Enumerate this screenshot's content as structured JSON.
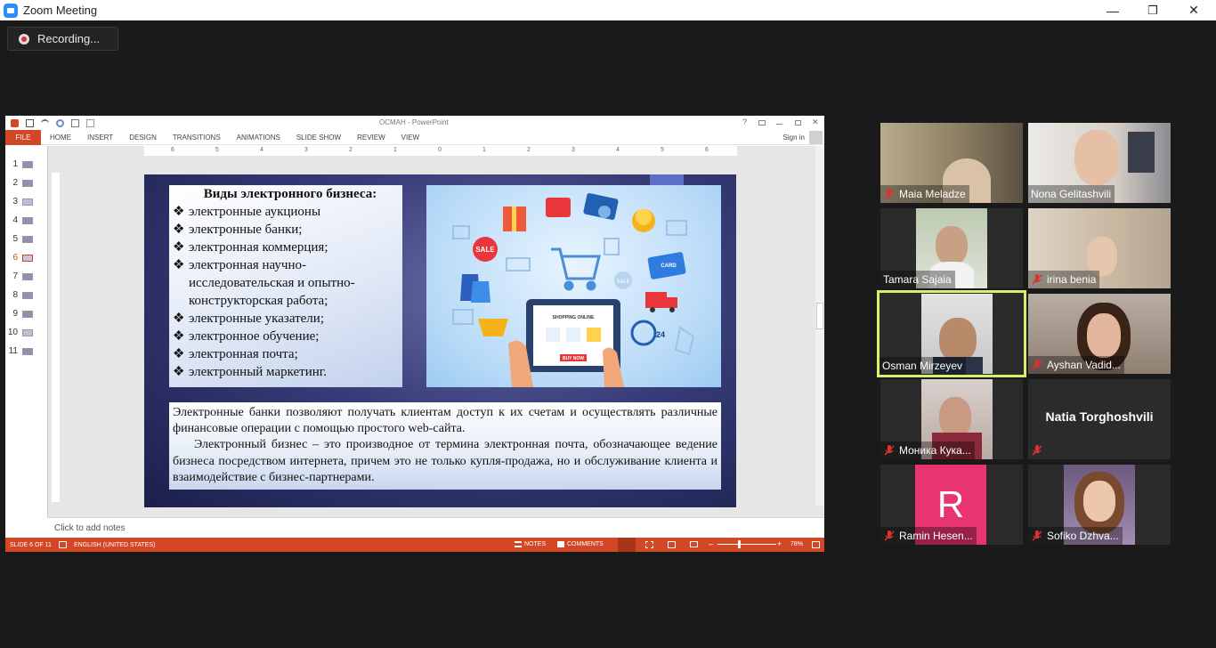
{
  "window": {
    "title": "Zoom Meeting",
    "minimize": "—",
    "restore": "❐",
    "close": "✕"
  },
  "recording": {
    "label": "Recording..."
  },
  "ppt": {
    "doc_title": "OCMAH - PowerPoint",
    "help": "?",
    "file_tab": "FILE",
    "tabs": [
      "HOME",
      "INSERT",
      "DESIGN",
      "TRANSITIONS",
      "ANIMATIONS",
      "SLIDE SHOW",
      "REVIEW",
      "VIEW"
    ],
    "signin": "Sign in",
    "slides": [
      "1",
      "2",
      "3",
      "4",
      "5",
      "6",
      "7",
      "8",
      "9",
      "10",
      "11"
    ],
    "ruler_marks": [
      "6",
      "5",
      "4",
      "3",
      "2",
      "1",
      "0",
      "1",
      "2",
      "3",
      "4",
      "5",
      "6"
    ],
    "notes_placeholder": "Click to add notes",
    "status": {
      "slide": "SLIDE 6 OF 11",
      "language": "ENGLISH (UNITED STATES)",
      "notes": "NOTES",
      "comments": "COMMENTS",
      "zoom": "78%"
    }
  },
  "slide": {
    "heading": "Виды электронного бизнеса:",
    "bullets": [
      {
        "b": "❖",
        "t": "электронные аукционы"
      },
      {
        "b": "❖",
        "t": "электронные банки;"
      },
      {
        "b": "❖",
        "t": "электронная коммерция;"
      },
      {
        "b": "❖",
        "t": "электронная научно-"
      },
      {
        "b": "",
        "t": "исследовательская и опытно-"
      },
      {
        "b": "",
        "t": "конструкторская работа;"
      },
      {
        "b": "❖",
        "t": "электронные указатели;"
      },
      {
        "b": "❖",
        "t": "электронное обучение;"
      },
      {
        "b": "❖",
        "t": " электронная почта;"
      },
      {
        "b": "❖",
        "t": "электронный маркетинг."
      }
    ],
    "image_labels": {
      "sale": "SALE",
      "sale2": "SALE",
      "card": "CARD",
      "shopping_online": "SHOPPING ONLINE",
      "buy_now": "BUY NOW",
      "clock_24": "24"
    },
    "paragraph1": "Электронные банки позволяют получать клиентам доступ к их счетам и осуществлять различные финансовые операции с помощью простого web-сайта.",
    "paragraph2": "Электронный бизнес – это производное от термина электронная почта, обозначающее ведение бизнеса посредством интернета, причем это не только купля-продажа, но и обслуживание клиента и взаимодействие с бизнес-партнерами."
  },
  "participants": [
    {
      "name": "Maia Meladze",
      "muted": true
    },
    {
      "name": "Nona Gelitashvili",
      "muted": false
    },
    {
      "name": "Tamara Sajaia",
      "muted": false
    },
    {
      "name": "irina benia",
      "muted": true
    },
    {
      "name": "Osman Mirzeyev",
      "muted": false,
      "speaking": true
    },
    {
      "name": "Ayshan Vadid...",
      "muted": true
    },
    {
      "name": "Моника Кука...",
      "muted": true
    },
    {
      "name": "Natia Torghoshvili",
      "muted": true,
      "video_off": true
    },
    {
      "name": "Ramin Hesen...",
      "muted": true,
      "avatar_letter": "R"
    },
    {
      "name": "Sofiko Dzhva...",
      "muted": true
    }
  ],
  "colors": {
    "ppt_accent": "#d24726",
    "speaking_border": "#d6f06e",
    "avatar_bg": "#e8356f",
    "zoom_blue": "#2d8cff",
    "muted_red": "#e0312f"
  }
}
